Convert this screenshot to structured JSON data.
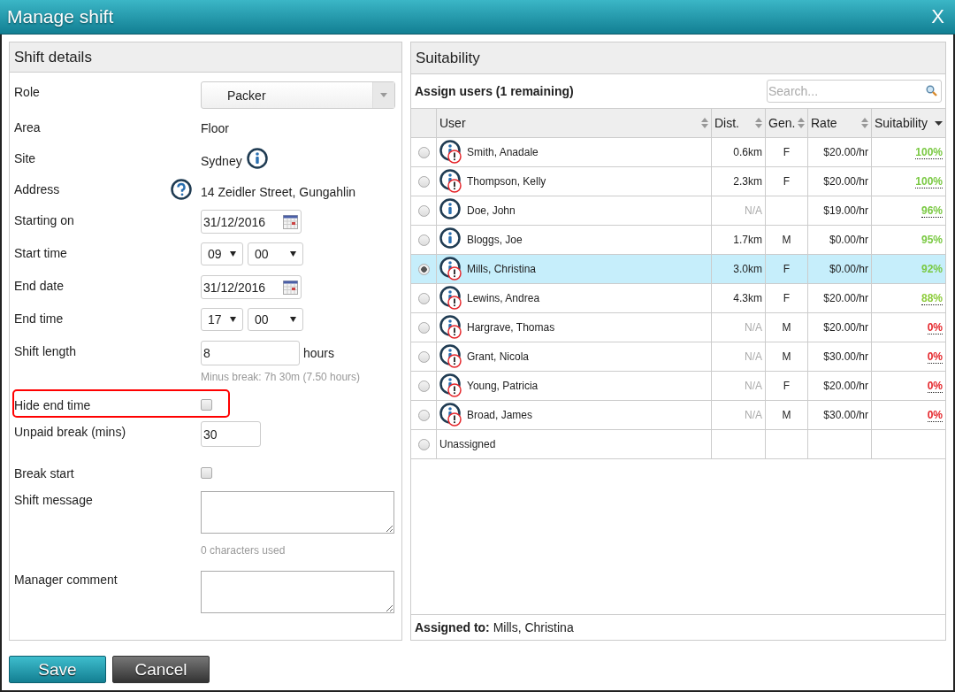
{
  "window": {
    "title": "Manage shift",
    "close": "X"
  },
  "shift_details": {
    "title": "Shift details",
    "fields": [
      {
        "kind": "select",
        "label": "Role",
        "value": "Packer"
      },
      {
        "kind": "text",
        "label": "Area",
        "value": "Floor"
      },
      {
        "kind": "text_info",
        "label": "Site",
        "value": "Sydney"
      },
      {
        "kind": "address",
        "label": "Address",
        "value": "14 Zeidler Street, Gungahlin"
      },
      {
        "kind": "date",
        "label": "Starting on",
        "value": "31/12/2016"
      },
      {
        "kind": "time",
        "label": "Start time",
        "hour": "09",
        "minute": "00"
      },
      {
        "kind": "date",
        "label": "End date",
        "value": "31/12/2016"
      },
      {
        "kind": "time",
        "label": "End time",
        "hour": "17",
        "minute": "00"
      },
      {
        "kind": "number",
        "label": "Shift length",
        "value": "8",
        "unit": "hours",
        "hint": "Minus break: 7h 30m (7.50 hours)"
      },
      {
        "kind": "checkbox",
        "label": "Hide end time",
        "checked": false,
        "highlighted": true
      },
      {
        "kind": "short",
        "label": "Unpaid break (mins)",
        "value": "30"
      },
      {
        "kind": "checkbox",
        "label": "Break start",
        "checked": false,
        "highlighted": false
      },
      {
        "kind": "textarea",
        "label": "Shift message",
        "hint": "0 characters used"
      },
      {
        "kind": "textarea",
        "label": "Manager comment"
      }
    ]
  },
  "suitability": {
    "title": "Suitability",
    "assign_label": "Assign users (1 remaining)",
    "search": {
      "placeholder": "Search..."
    },
    "columns": [
      {
        "label": "User",
        "kind": "sortable"
      },
      {
        "label": "Dist.",
        "kind": "sortable"
      },
      {
        "label": "Gen.",
        "kind": "sortable"
      },
      {
        "label": "Rate",
        "kind": "sortable"
      },
      {
        "label": "Suitability",
        "kind": "sorted"
      }
    ],
    "rows": [
      {
        "user": "Smith, Anadale",
        "warning": true,
        "dist": "0.6km",
        "dist_muted": false,
        "gender": "F",
        "rate": "$20.00/hr",
        "suitability": "100%",
        "color": "#7ac943",
        "underline": true,
        "selected": false
      },
      {
        "user": "Thompson, Kelly",
        "warning": true,
        "dist": "2.3km",
        "dist_muted": false,
        "gender": "F",
        "rate": "$20.00/hr",
        "suitability": "100%",
        "color": "#7ac943",
        "underline": true,
        "selected": false
      },
      {
        "user": "Doe, John",
        "warning": false,
        "dist": "N/A",
        "dist_muted": true,
        "gender": "",
        "rate": "$19.00/hr",
        "suitability": "96%",
        "color": "#7ac943",
        "underline": true,
        "selected": false
      },
      {
        "user": "Bloggs, Joe",
        "warning": false,
        "dist": "1.7km",
        "dist_muted": false,
        "gender": "M",
        "rate": "$0.00/hr",
        "suitability": "95%",
        "color": "#7ac943",
        "underline": false,
        "selected": false
      },
      {
        "user": "Mills, Christina",
        "warning": true,
        "dist": "3.0km",
        "dist_muted": false,
        "gender": "F",
        "rate": "$0.00/hr",
        "suitability": "92%",
        "color": "#7ac943",
        "underline": false,
        "selected": true
      },
      {
        "user": "Lewins, Andrea",
        "warning": true,
        "dist": "4.3km",
        "dist_muted": false,
        "gender": "F",
        "rate": "$20.00/hr",
        "suitability": "88%",
        "color": "#8ccc3a",
        "underline": true,
        "selected": false
      },
      {
        "user": "Hargrave, Thomas",
        "warning": true,
        "dist": "N/A",
        "dist_muted": true,
        "gender": "M",
        "rate": "$20.00/hr",
        "suitability": "0%",
        "color": "#e5262b",
        "underline": true,
        "selected": false
      },
      {
        "user": "Grant, Nicola",
        "warning": true,
        "dist": "N/A",
        "dist_muted": true,
        "gender": "M",
        "rate": "$30.00/hr",
        "suitability": "0%",
        "color": "#e5262b",
        "underline": true,
        "selected": false
      },
      {
        "user": "Young, Patricia",
        "warning": true,
        "dist": "N/A",
        "dist_muted": true,
        "gender": "F",
        "rate": "$20.00/hr",
        "suitability": "0%",
        "color": "#e5262b",
        "underline": true,
        "selected": false
      },
      {
        "user": "Broad, James",
        "warning": true,
        "dist": "N/A",
        "dist_muted": true,
        "gender": "M",
        "rate": "$30.00/hr",
        "suitability": "0%",
        "color": "#e5262b",
        "underline": true,
        "selected": false
      }
    ],
    "unassigned": {
      "label": "Unassigned",
      "selected": false
    },
    "assigned": {
      "label": "Assigned to:",
      "value": "Mills, Christina"
    }
  },
  "buttons": [
    {
      "kind": "primary",
      "label": "Save"
    },
    {
      "kind": "secondary",
      "label": "Cancel"
    }
  ]
}
